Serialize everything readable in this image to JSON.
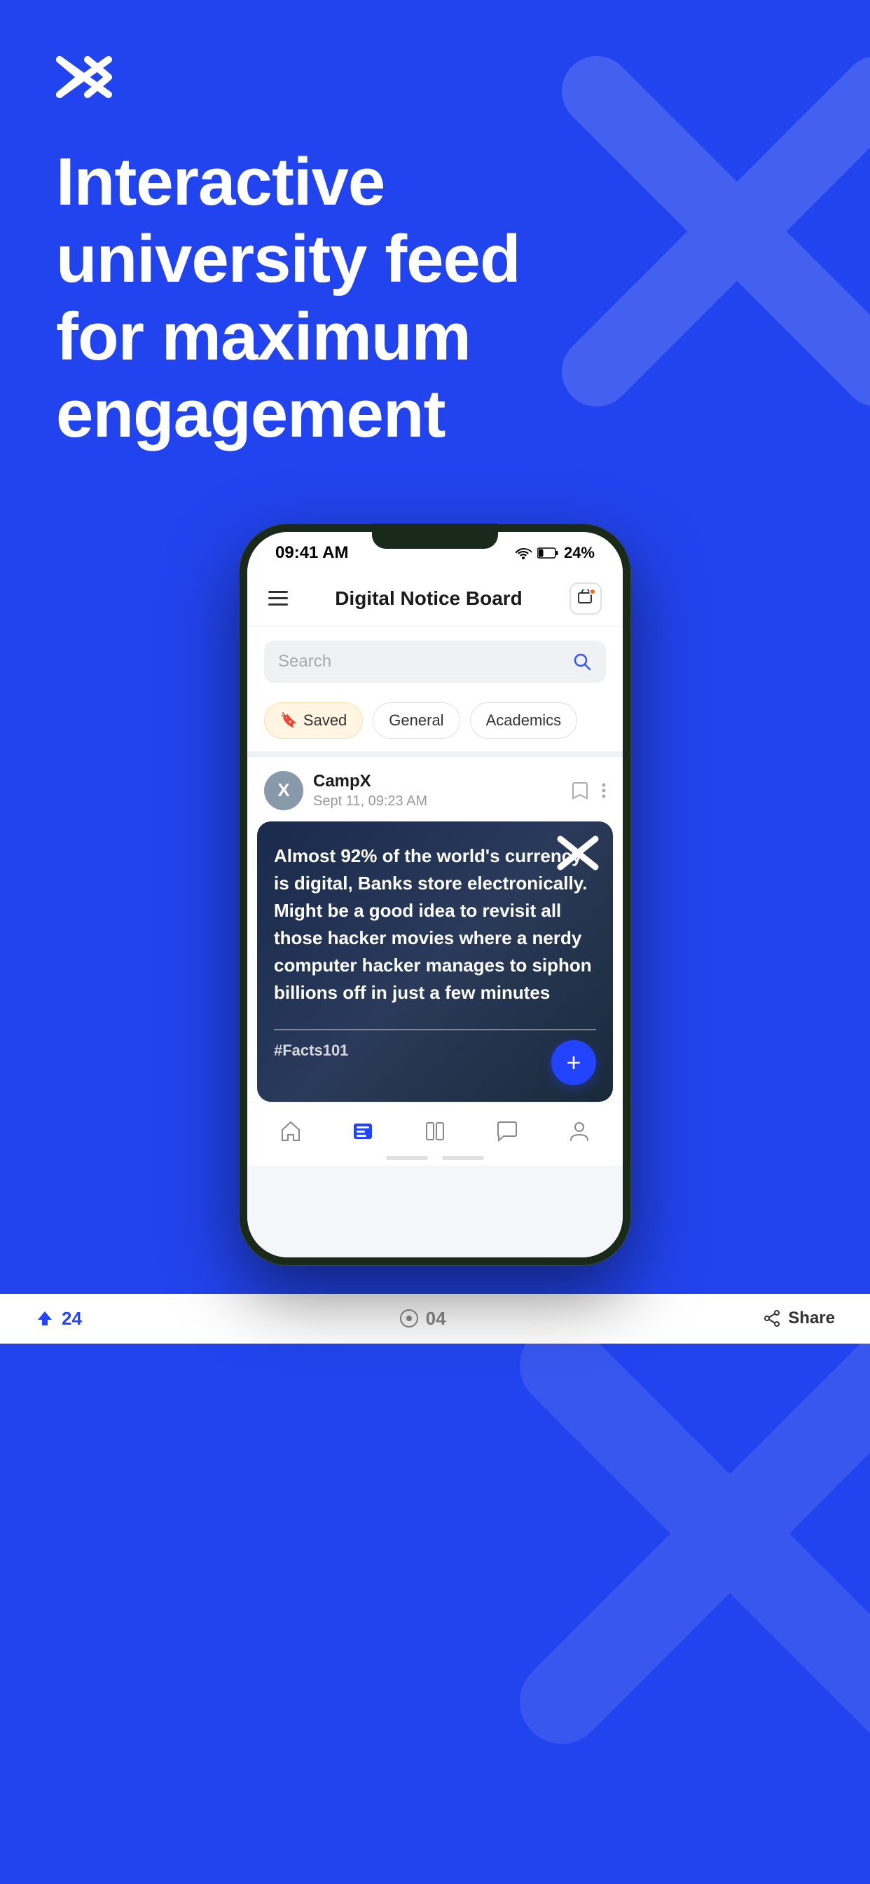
{
  "background_color": "#2244ee",
  "logo": {
    "symbol": "✕",
    "alt": "CampX Logo"
  },
  "headline": "Interactive university feed for maximum engagement",
  "phone": {
    "status_bar": {
      "time": "09:41 AM",
      "battery": "24%",
      "wifi": true
    },
    "app_header": {
      "title": "Digital Notice Board",
      "notification_label": "Notifications"
    },
    "search": {
      "placeholder": "Search"
    },
    "filter_chips": [
      {
        "label": "Saved",
        "type": "saved",
        "icon": "🔖"
      },
      {
        "label": "General",
        "type": "general"
      },
      {
        "label": "Academics",
        "type": "academics"
      }
    ],
    "post": {
      "author": "CampX",
      "timestamp": "Sept 11, 09:23 AM",
      "content": "Almost 92% of the world's currency is digital, Banks store electronically. Might be a good idea to revisit all those hacker movies where a nerdy computer hacker manages to siphon billions off in just a few minutes",
      "hashtag": "#Facts101",
      "fab_label": "+"
    },
    "bottom_nav": {
      "items": [
        {
          "name": "Home",
          "icon": "home",
          "active": false
        },
        {
          "name": "Feed",
          "icon": "feed",
          "active": true
        },
        {
          "name": "Library",
          "icon": "library",
          "active": false
        },
        {
          "name": "Chat",
          "icon": "chat",
          "active": false
        },
        {
          "name": "Profile",
          "icon": "profile",
          "active": false
        }
      ]
    },
    "bottom_stats": {
      "upvotes": "24",
      "comments": "04",
      "share_label": "Share"
    }
  }
}
